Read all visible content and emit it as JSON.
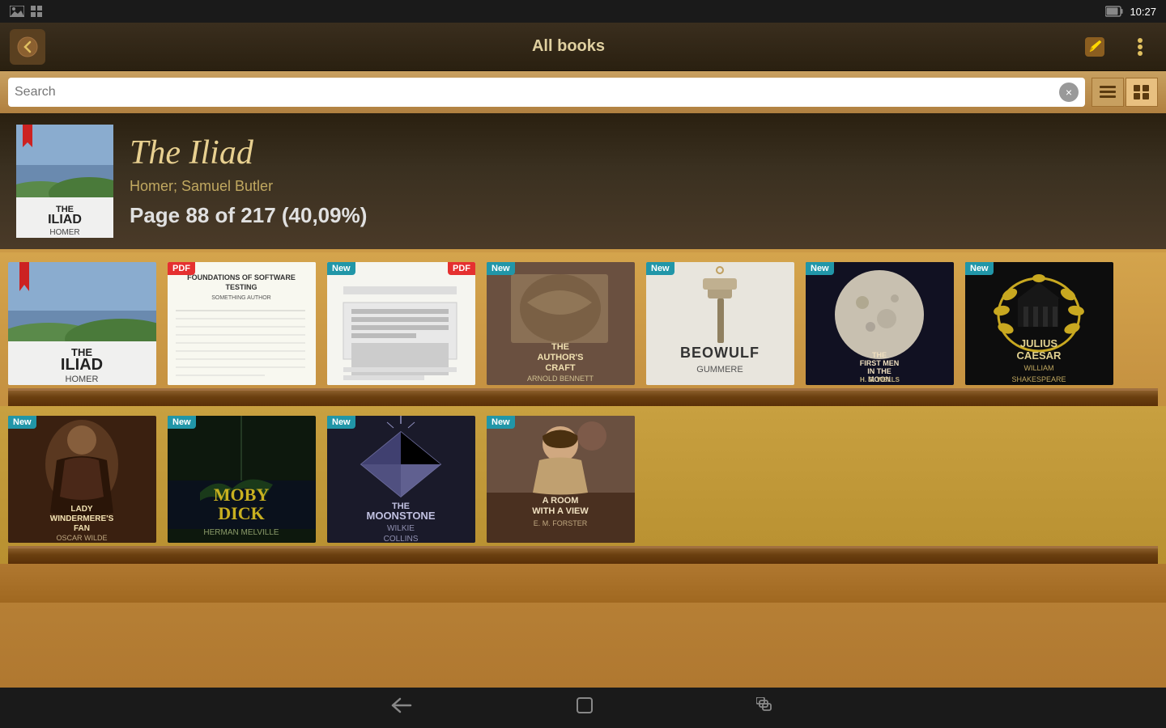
{
  "statusBar": {
    "time": "10:27",
    "icons": [
      "battery",
      "wifi"
    ]
  },
  "toolbar": {
    "title": "All books",
    "backLabel": "←",
    "editLabel": "✎",
    "menuLabel": "⋮"
  },
  "search": {
    "placeholder": "Search",
    "clearLabel": "×",
    "listViewLabel": "≡",
    "gridViewLabel": "⊞"
  },
  "currentBook": {
    "title": "The Iliad",
    "author": "Homer; Samuel Butler",
    "progress": "Page 88 of 217 (40,09%)"
  },
  "shelves": [
    {
      "books": [
        {
          "id": "iliad",
          "title": "THE\nILIAD\nHOMER",
          "badge": null,
          "style": "iliad"
        },
        {
          "id": "foundations",
          "title": "FOUNDATIONS OF SOFTWARE TESTING",
          "badge": "PDF",
          "style": "foundations"
        },
        {
          "id": "pdf2",
          "title": "",
          "badge": "New PDF",
          "style": "pdf2"
        },
        {
          "id": "authors-craft",
          "title": "THE\nAUTHOR'S\nCRAFT\nARNOLD\nBENNETT",
          "badge": "New",
          "style": "authors-craft"
        },
        {
          "id": "beowulf",
          "title": "BEOWULF\nGUMMERE",
          "badge": "New",
          "style": "beowulf"
        },
        {
          "id": "first-men",
          "title": "THE\nFIRST MEN\nIN THE\nMOON\nH. G. WELLS",
          "badge": "New",
          "style": "first-men"
        },
        {
          "id": "julius",
          "title": "JULIUS\nCAESAR\nWILLIAM\nSHAKESPEARE",
          "badge": "New",
          "style": "julius"
        }
      ]
    },
    {
      "books": [
        {
          "id": "lady",
          "title": "LADY\nWINDERMERE'S\nFAN\nOSCAR WILDE",
          "badge": "New",
          "style": "lady"
        },
        {
          "id": "moby",
          "title": "MOBY\nDICK\nHERMAN MELVILLE",
          "badge": "New",
          "style": "moby"
        },
        {
          "id": "moonstone",
          "title": "THE\nMOONSTONE\nWILKIE\nCOLLINS",
          "badge": "New",
          "style": "moonstone"
        },
        {
          "id": "room",
          "title": "A ROOM\nWITH A VIEW\nE. M. FORSTER",
          "badge": "New",
          "style": "room"
        }
      ]
    }
  ],
  "navBar": {
    "backLabel": "←",
    "homeLabel": "⌂",
    "recentLabel": "▣"
  }
}
